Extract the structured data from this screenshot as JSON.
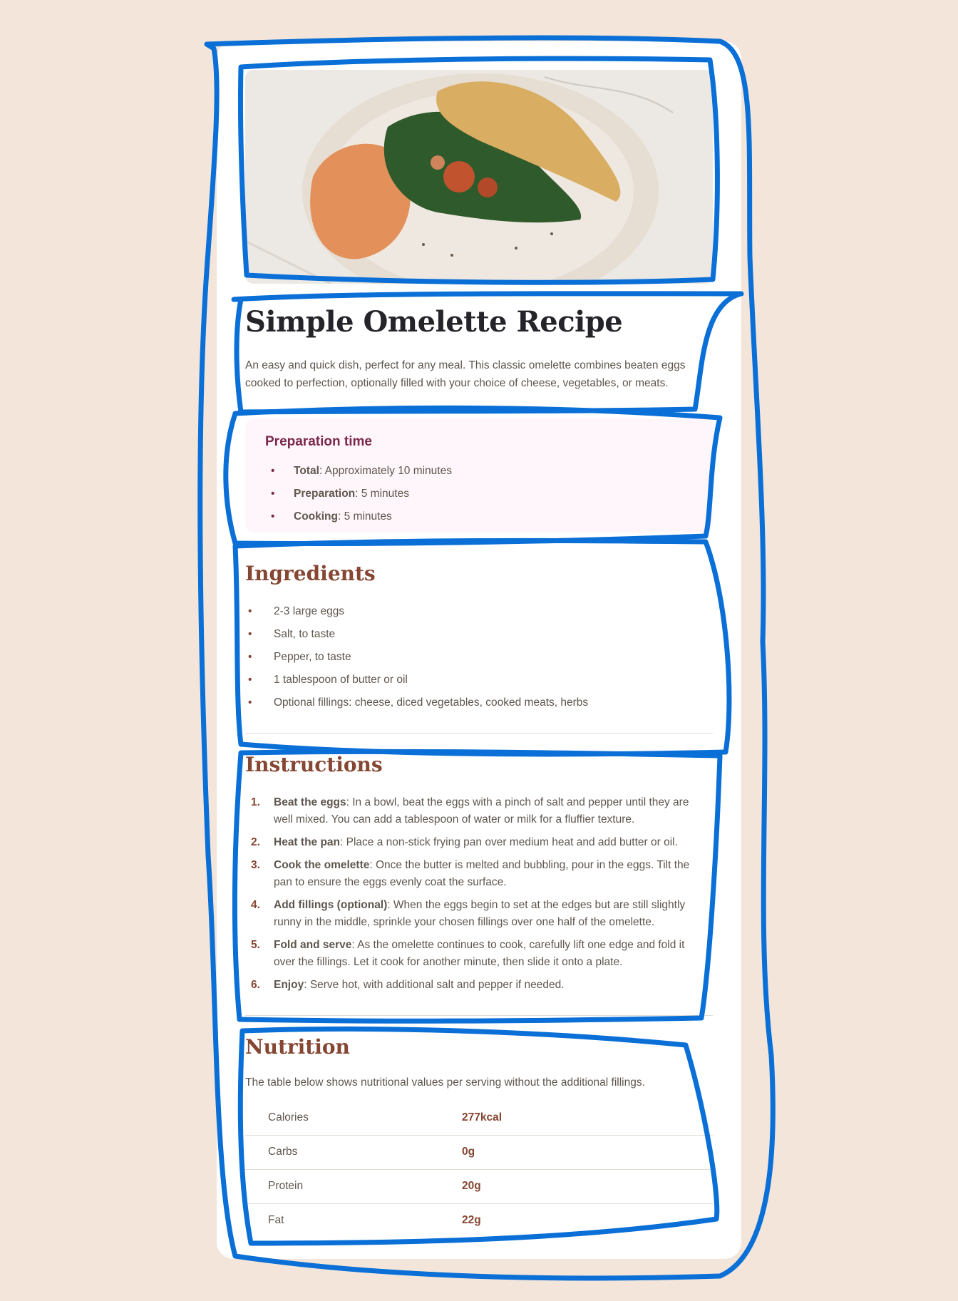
{
  "recipe": {
    "title": "Simple Omelette Recipe",
    "intro": "An easy and quick dish, perfect for any meal. This classic omelette combines beaten eggs cooked to perfection, optionally filled with your choice of cheese, vegetables, or meats."
  },
  "prep": {
    "heading": "Preparation time",
    "items": [
      {
        "label": "Total",
        "value": ": Approximately 10 minutes"
      },
      {
        "label": "Preparation",
        "value": ": 5 minutes"
      },
      {
        "label": "Cooking",
        "value": ": 5 minutes"
      }
    ]
  },
  "ingredients": {
    "heading": "Ingredients",
    "items": [
      "2-3 large eggs",
      "Salt, to taste",
      "Pepper, to taste",
      "1 tablespoon of butter or oil",
      "Optional fillings: cheese, diced vegetables, cooked meats, herbs"
    ]
  },
  "instructions": {
    "heading": "Instructions",
    "steps": [
      {
        "num": "1.",
        "label": "Beat the eggs",
        "text": ": In a bowl, beat the eggs with a pinch of salt and pepper until they are well mixed. You can add a tablespoon of water or milk for a fluffier texture."
      },
      {
        "num": "2.",
        "label": "Heat the pan",
        "text": ": Place a non-stick frying pan over medium heat and add butter or oil."
      },
      {
        "num": "3.",
        "label": "Cook the omelette",
        "text": ": Once the butter is melted and bubbling, pour in the eggs. Tilt the pan to ensure the eggs evenly coat the surface."
      },
      {
        "num": "4.",
        "label": "Add fillings (optional)",
        "text": ": When the eggs begin to set at the edges but are still slightly runny in the middle, sprinkle your chosen fillings over one half of the omelette."
      },
      {
        "num": "5.",
        "label": "Fold and serve",
        "text": ": As the omelette continues to cook, carefully lift one edge and fold it over the fillings. Let it cook for another minute, then slide it onto a plate."
      },
      {
        "num": "6.",
        "label": "Enjoy",
        "text": ": Serve hot, with additional salt and pepper if needed."
      }
    ]
  },
  "nutrition": {
    "heading": "Nutrition",
    "description": "The table below shows nutritional values per serving without the additional fillings.",
    "rows": [
      {
        "label": "Calories",
        "value": "277kcal"
      },
      {
        "label": "Carbs",
        "value": "0g"
      },
      {
        "label": "Protein",
        "value": "20g"
      },
      {
        "label": "Fat",
        "value": "22g"
      }
    ]
  },
  "colors": {
    "page_bg": "#f3e5d9",
    "card_bg": "#ffffff",
    "heading_brown": "#854632",
    "prep_bg": "#fff6fb",
    "prep_heading": "#7a284b",
    "annotation_blue": "#0a6fd6"
  },
  "image": {
    "subject": "omelette with spinach and hummus on a plate"
  }
}
